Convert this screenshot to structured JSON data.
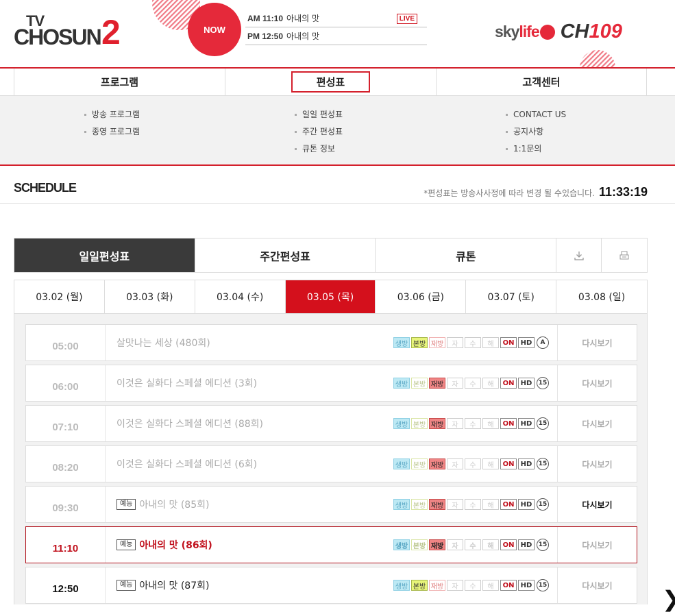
{
  "header": {
    "logo_tv": "TV",
    "logo_chosun": "CHOSUN",
    "logo_two": "2",
    "now_label": "NOW",
    "now_list": [
      {
        "time": "AM 11:10",
        "title": "아내의 맛",
        "live": "LIVE"
      },
      {
        "time": "PM 12:50",
        "title": "아내의 맛"
      }
    ],
    "skylife_a": "sky",
    "skylife_b": "life",
    "channel_prefix": "CH",
    "channel_num": "109"
  },
  "gnb": [
    {
      "label": "프로그램"
    },
    {
      "label": "편성표"
    },
    {
      "label": "고객센터"
    }
  ],
  "submenu": {
    "col1": [
      "방송 프로그램",
      "종영 프로그램"
    ],
    "col2": [
      "일일 편성표",
      "주간 편성표",
      "큐톤 정보"
    ],
    "col3": [
      "CONTACT US",
      "공지사항",
      "1:1문의"
    ]
  },
  "schedule": {
    "title": "SCHEDULE",
    "note": "*편성표는 방송사사정에 따라 변경 될 수있습니다.",
    "clock": "11:33:19"
  },
  "tabs": [
    "일일편성표",
    "주간편성표",
    "큐톤"
  ],
  "tab_icons": [
    "download-icon",
    "print-icon"
  ],
  "dates": [
    "03.02 (월)",
    "03.03 (화)",
    "03.04 (수)",
    "03.05 (목)",
    "03.06 (금)",
    "03.07 (토)",
    "03.08 (일)"
  ],
  "active_date": "03.05 (목)",
  "badge_labels": {
    "live": "생방",
    "first": "본방",
    "rerun": "재방",
    "sub": "자",
    "sign": "수",
    "comm": "해",
    "on": "ON",
    "hd": "HD"
  },
  "programs": [
    {
      "time": "05:00",
      "genre": "",
      "title": "살맛나는 세상 (480회)",
      "rating": "A",
      "status": "past",
      "replay": "다시보기",
      "first": true,
      "rerun": false
    },
    {
      "time": "06:00",
      "genre": "",
      "title": "이것은 실화다 스페셜 에디션 (3회)",
      "rating": "15",
      "status": "past",
      "replay": "다시보기",
      "first": false,
      "rerun": true
    },
    {
      "time": "07:10",
      "genre": "",
      "title": "이것은 실화다 스페셜 에디션 (88회)",
      "rating": "15",
      "status": "past",
      "replay": "다시보기",
      "first": false,
      "rerun": true
    },
    {
      "time": "08:20",
      "genre": "",
      "title": "이것은 실화다 스페셜 에디션 (6회)",
      "rating": "15",
      "status": "past",
      "replay": "다시보기",
      "first": false,
      "rerun": true
    },
    {
      "time": "09:30",
      "genre": "예능",
      "title": "아내의 맛 (85회)",
      "rating": "15",
      "status": "past",
      "replay": "다시보기",
      "first": false,
      "rerun": true,
      "replay_on": true
    },
    {
      "time": "11:10",
      "genre": "예능",
      "title": "아내의 맛 (86회)",
      "rating": "15",
      "status": "current",
      "replay": "다시보기",
      "first": false,
      "rerun": true
    },
    {
      "time": "12:50",
      "genre": "예능",
      "title": "아내의 맛 (87회)",
      "rating": "15",
      "status": "future",
      "replay": "다시보기",
      "first": true,
      "rerun": false
    }
  ],
  "next_arrow": "❯"
}
